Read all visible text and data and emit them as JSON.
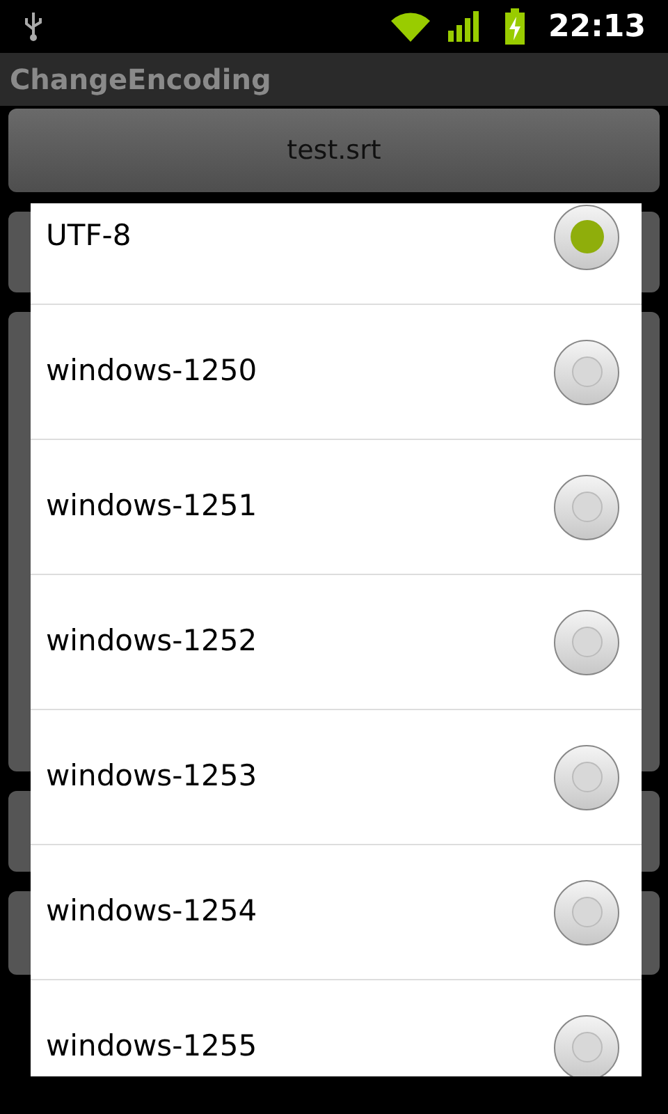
{
  "status_bar": {
    "time": "22:13"
  },
  "app_bar": {
    "title": "ChangeEncoding"
  },
  "file_button": {
    "label": "test.srt"
  },
  "dialog": {
    "options": [
      {
        "label": "UTF-8",
        "selected": true
      },
      {
        "label": "windows-1250",
        "selected": false
      },
      {
        "label": "windows-1251",
        "selected": false
      },
      {
        "label": "windows-1252",
        "selected": false
      },
      {
        "label": "windows-1253",
        "selected": false
      },
      {
        "label": "windows-1254",
        "selected": false
      },
      {
        "label": "windows-1255",
        "selected": false
      }
    ]
  }
}
